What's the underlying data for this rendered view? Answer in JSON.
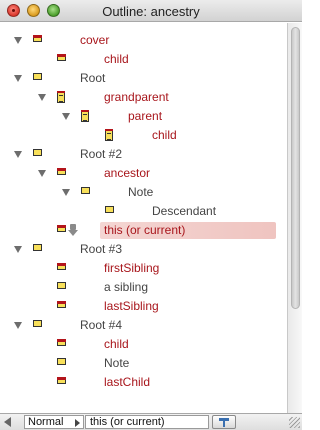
{
  "window": {
    "title": "Outline: ancestry"
  },
  "outline": {
    "rows": [
      {
        "label": "cover",
        "style": "red"
      },
      {
        "label": "child",
        "style": "red"
      },
      {
        "label": "Root",
        "style": "gray"
      },
      {
        "label": "grandparent",
        "style": "red"
      },
      {
        "label": "parent",
        "style": "red"
      },
      {
        "label": "child",
        "style": "red"
      },
      {
        "label": "Root #2",
        "style": "gray"
      },
      {
        "label": "ancestor",
        "style": "red"
      },
      {
        "label": "Note",
        "style": "gray"
      },
      {
        "label": "Descendant",
        "style": "gray"
      },
      {
        "label": "this (or current)",
        "style": "red",
        "selected": true
      },
      {
        "label": "Root #3",
        "style": "gray"
      },
      {
        "label": "firstSibling",
        "style": "red"
      },
      {
        "label": "a sibling",
        "style": "gray"
      },
      {
        "label": "lastSibling",
        "style": "red"
      },
      {
        "label": "Root #4",
        "style": "gray"
      },
      {
        "label": "child",
        "style": "red"
      },
      {
        "label": "Note",
        "style": "gray"
      },
      {
        "label": "lastChild",
        "style": "red"
      }
    ]
  },
  "bottom_bar": {
    "style_value": "Normal",
    "path_value": "this (or current)"
  },
  "colors": {
    "red_text": "#a8161c",
    "gray_text": "#444444",
    "selection": "#efc4c0"
  }
}
